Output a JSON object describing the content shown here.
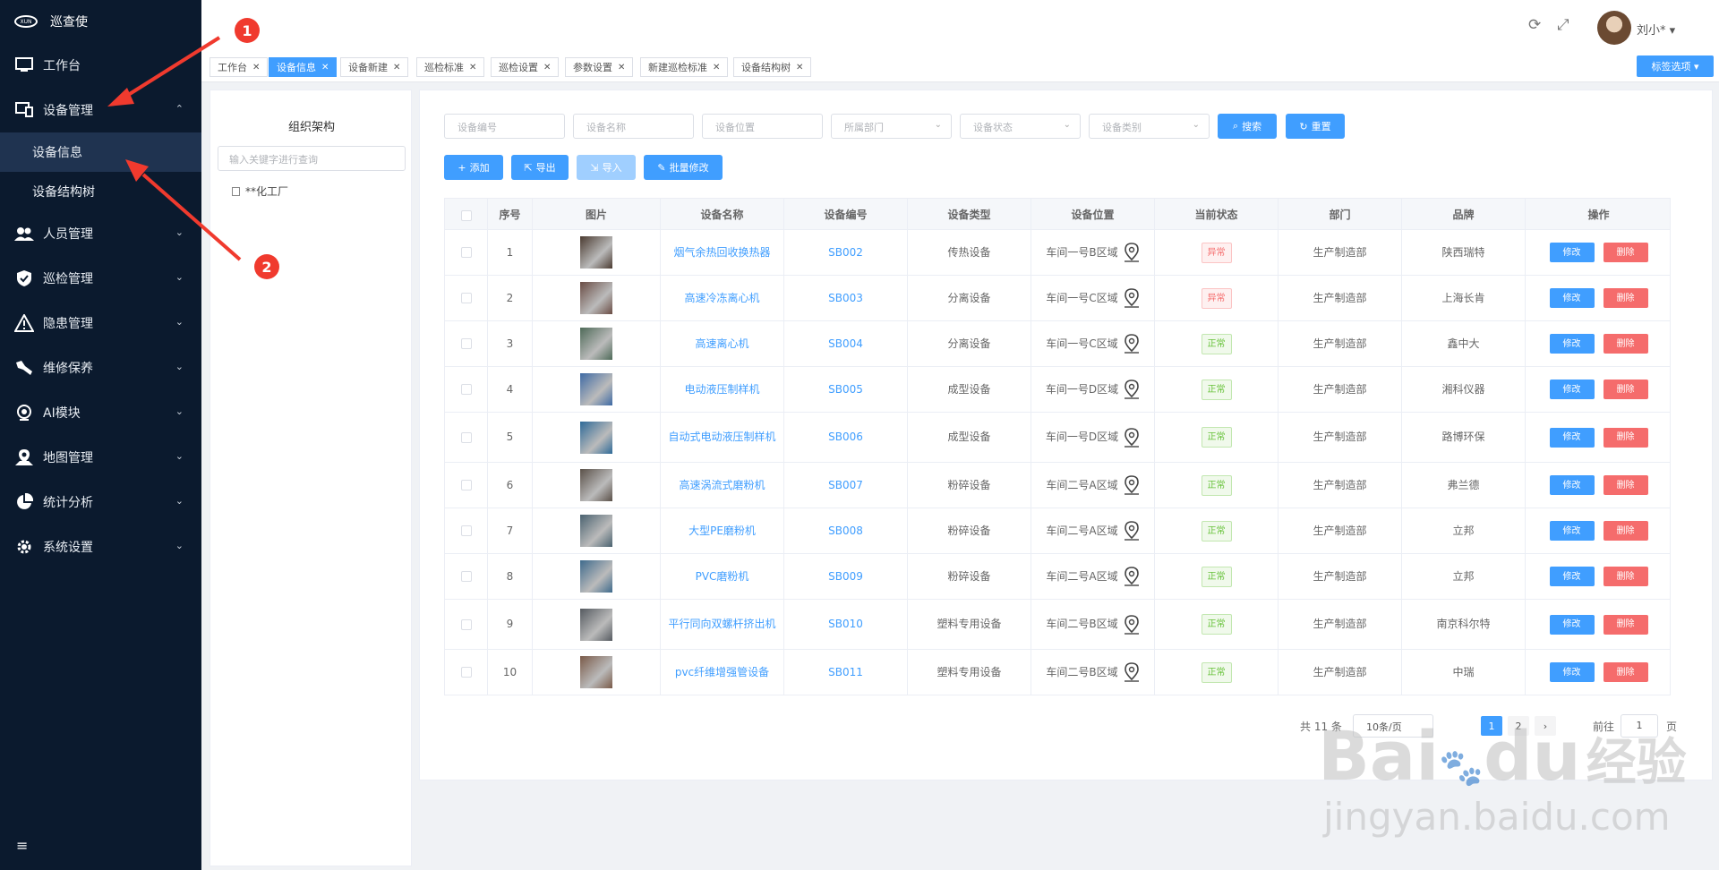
{
  "sidebar": {
    "brand": "巡查使",
    "brand_logo_text": "XUN",
    "items": [
      {
        "label": "工作台"
      },
      {
        "label": "设备管理"
      },
      {
        "label": "人员管理"
      },
      {
        "label": "巡检管理"
      },
      {
        "label": "隐患管理"
      },
      {
        "label": "维修保养"
      },
      {
        "label": "AI模块"
      },
      {
        "label": "地图管理"
      },
      {
        "label": "统计分析"
      },
      {
        "label": "系统设置"
      }
    ],
    "sub_items": [
      {
        "label": "设备信息",
        "active": true
      },
      {
        "label": "设备结构树",
        "active": false
      }
    ],
    "toggle_icon": "≡"
  },
  "header": {
    "refresh_icon": "⟳",
    "fullscreen_icon": "⤢",
    "username": "刘小* ▾"
  },
  "tags": [
    {
      "label": "工作台",
      "active": false
    },
    {
      "label": "设备信息",
      "active": true
    },
    {
      "label": "设备新建",
      "active": false
    },
    {
      "label": "巡检标准",
      "active": false
    },
    {
      "label": "巡检设置",
      "active": false
    },
    {
      "label": "参数设置",
      "active": false
    },
    {
      "label": "新建巡检标准",
      "active": false
    },
    {
      "label": "设备结构树",
      "active": false
    }
  ],
  "tag_options_label": "标签选项 ▾",
  "org": {
    "title": "组织架构",
    "search_placeholder": "输入关键字进行查询",
    "node": "**化工厂"
  },
  "filters": {
    "code": "设备编号",
    "name": "设备名称",
    "location": "设备位置",
    "department": "所属部门",
    "status": "设备状态",
    "category": "设备类别",
    "search_btn": "搜索",
    "reset_btn": "重置"
  },
  "actions": {
    "add": "添加",
    "export": "导出",
    "import": "导入",
    "batch_edit": "批量修改"
  },
  "table": {
    "columns": [
      "序号",
      "图片",
      "设备名称",
      "设备编号",
      "设备类型",
      "设备位置",
      "当前状态",
      "部门",
      "品牌",
      "操作"
    ],
    "edit_label": "修改",
    "delete_label": "删除",
    "rows": [
      {
        "index": "1",
        "name": "烟气余热回收换热器",
        "code": "SB002",
        "type": "传热设备",
        "location": "车间一号B区域",
        "status": "异常",
        "status_kind": "bad",
        "dept": "生产制造部",
        "brand": "陕西瑞特",
        "thumb": "#4a3a30"
      },
      {
        "index": "2",
        "name": "高速冷冻离心机",
        "code": "SB003",
        "type": "分离设备",
        "location": "车间一号C区域",
        "status": "异常",
        "status_kind": "bad",
        "dept": "生产制造部",
        "brand": "上海长肯",
        "thumb": "#6a4c44"
      },
      {
        "index": "3",
        "name": "高速离心机",
        "code": "SB004",
        "type": "分离设备",
        "location": "车间一号C区域",
        "status": "正常",
        "status_kind": "ok",
        "dept": "生产制造部",
        "brand": "鑫中大",
        "thumb": "#4e6a58"
      },
      {
        "index": "4",
        "name": "电动液压制样机",
        "code": "SB005",
        "type": "成型设备",
        "location": "车间一号D区域",
        "status": "正常",
        "status_kind": "ok",
        "dept": "生产制造部",
        "brand": "湘科仪器",
        "thumb": "#3e6aa4"
      },
      {
        "index": "5",
        "name": "自动式电动液压制样机",
        "code": "SB006",
        "type": "成型设备",
        "location": "车间一号D区域",
        "status": "正常",
        "status_kind": "ok",
        "dept": "生产制造部",
        "brand": "路博环保",
        "thumb": "#2e6a98"
      },
      {
        "index": "6",
        "name": "高速涡流式磨粉机",
        "code": "SB007",
        "type": "粉碎设备",
        "location": "车间二号A区域",
        "status": "正常",
        "status_kind": "ok",
        "dept": "生产制造部",
        "brand": "弗兰德",
        "thumb": "#5a5048"
      },
      {
        "index": "7",
        "name": "大型PE磨粉机",
        "code": "SB008",
        "type": "粉碎设备",
        "location": "车间二号A区域",
        "status": "正常",
        "status_kind": "ok",
        "dept": "生产制造部",
        "brand": "立邦",
        "thumb": "#4a6270"
      },
      {
        "index": "8",
        "name": "PVC磨粉机",
        "code": "SB009",
        "type": "粉碎设备",
        "location": "车间二号A区域",
        "status": "正常",
        "status_kind": "ok",
        "dept": "生产制造部",
        "brand": "立邦",
        "thumb": "#3e6a8c"
      },
      {
        "index": "9",
        "name": "平行同向双螺杆挤出机",
        "code": "SB010",
        "type": "塑料专用设备",
        "location": "车间二号B区域",
        "status": "正常",
        "status_kind": "ok",
        "dept": "生产制造部",
        "brand": "南京科尔特",
        "thumb": "#555a60"
      },
      {
        "index": "10",
        "name": "pvc纤维增强管设备",
        "code": "SB011",
        "type": "塑料专用设备",
        "location": "车间二号B区域",
        "status": "正常",
        "status_kind": "ok",
        "dept": "生产制造部",
        "brand": "中瑞",
        "thumb": "#7a5a48"
      }
    ]
  },
  "pagination": {
    "total": "共 11 条",
    "page_size": "10条/页",
    "pages": [
      "1",
      "2"
    ],
    "current": "1",
    "next": "›",
    "goto_label": "前往",
    "goto_value": "1",
    "goto_suffix": "页"
  },
  "annotations": [
    "1",
    "2"
  ],
  "watermark": {
    "brand": "Bai",
    "brand2": "du",
    "cn": "经验",
    "url": "jingyan.baidu.com"
  },
  "colors": {
    "sidebar_bg": "#0b1a2e",
    "primary": "#409eff",
    "danger": "#f56c6c",
    "success": "#67c23a",
    "annotation": "#f03a2e"
  }
}
